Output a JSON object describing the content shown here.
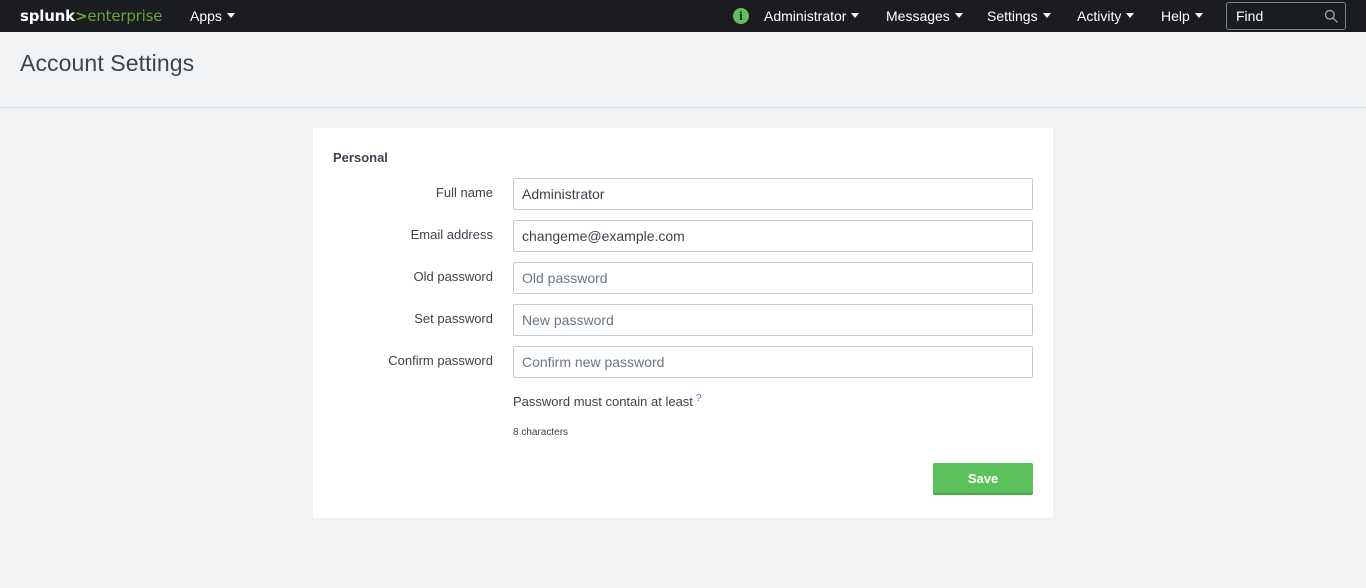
{
  "brand": {
    "name": "splunk",
    "separator": ">",
    "product": "enterprise"
  },
  "nav": {
    "apps": "Apps",
    "user": "Administrator",
    "messages": "Messages",
    "settings": "Settings",
    "activity": "Activity",
    "help": "Help",
    "status_icon": "i",
    "find_placeholder": "Find"
  },
  "page": {
    "title": "Account Settings"
  },
  "form": {
    "section": "Personal",
    "fields": [
      {
        "label": "Full name",
        "value": "Administrator",
        "placeholder": ""
      },
      {
        "label": "Email address",
        "value": "changeme@example.com",
        "placeholder": ""
      },
      {
        "label": "Old password",
        "value": "",
        "placeholder": "Old password"
      },
      {
        "label": "Set password",
        "value": "",
        "placeholder": "New password"
      },
      {
        "label": "Confirm password",
        "value": "",
        "placeholder": "Confirm new password"
      }
    ],
    "help_text": "Password must contain at least",
    "help_link": "?",
    "rule": "8 characters",
    "save_label": "Save"
  },
  "colors": {
    "topbar": "#1a1c20",
    "accent_green": "#5cc05c",
    "brand_green": "#65a637",
    "background": "#f2f3f5"
  }
}
